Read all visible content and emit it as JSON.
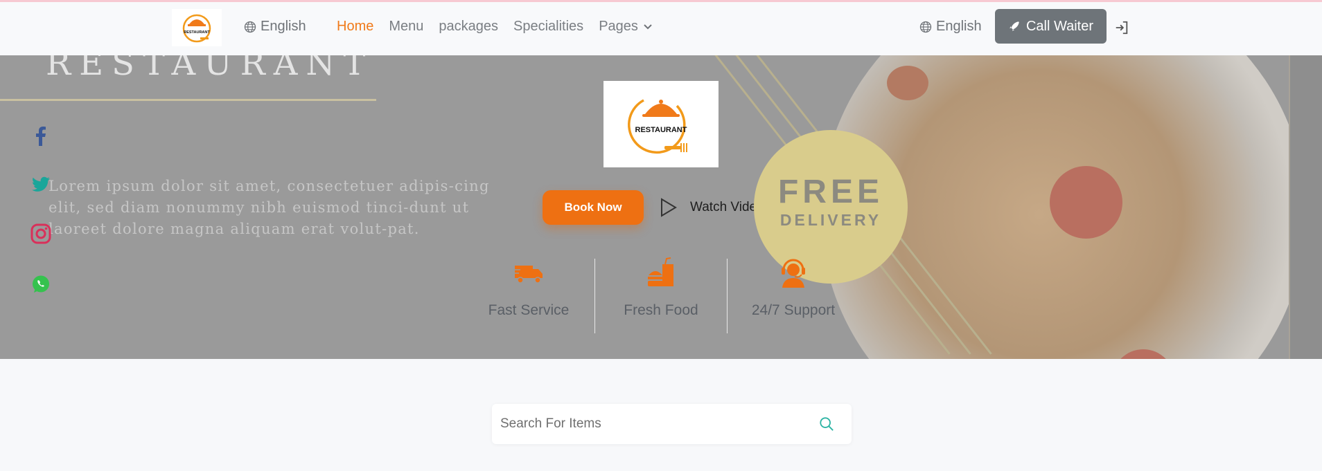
{
  "navbar": {
    "logo_text": "RESTAURANT",
    "language_left": "English",
    "links": [
      "Home",
      "Menu",
      "packages",
      "Specialities",
      "Pages"
    ],
    "active_link": "Home",
    "language_right": "English",
    "call_waiter_label": "Call Waiter",
    "icons": {
      "globe": "globe-icon",
      "rocket": "rocket-icon",
      "login": "sign-in-icon",
      "chevron": "chevron-down-icon"
    }
  },
  "hero": {
    "title": "RESTAURANT",
    "description": "Lorem ipsum dolor sit amet, consectetuer adipis-cing elit, sed diam nonummy nibh euismod tinci-dunt ut laoreet dolore magna aliquam erat volut-pat.",
    "logo_text": "RESTAURANT",
    "book_now_label": "Book Now",
    "watch_video_label": "Watch Video",
    "badge_line1": "FREE",
    "badge_line2": "DELIVERY",
    "social": [
      "facebook-icon",
      "twitter-icon",
      "instagram-icon",
      "whatsapp-icon"
    ],
    "features": [
      {
        "icon": "delivery-truck-icon",
        "label": "Fast Service"
      },
      {
        "icon": "burger-drink-icon",
        "label": "Fresh Food"
      },
      {
        "icon": "support-agent-icon",
        "label": "24/7 Support"
      }
    ]
  },
  "search": {
    "placeholder": "Search For Items"
  },
  "colors": {
    "accent": "#f07a1a",
    "button_gray": "#6e7479",
    "teal_icon": "#2bb3a3"
  }
}
